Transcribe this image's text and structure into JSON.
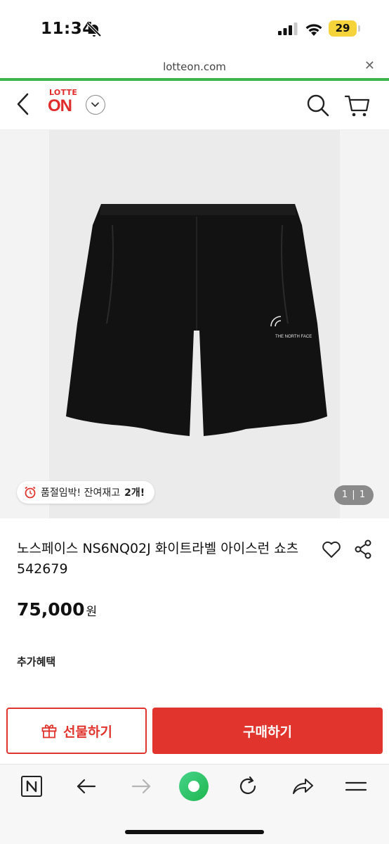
{
  "status_bar": {
    "time": "11:34",
    "battery_level": "29"
  },
  "browser": {
    "url": "lotteon.com",
    "close_label": "✕",
    "load_progress": 1.0
  },
  "header": {
    "logo_top": "LOTTE",
    "logo_main": "ON"
  },
  "gallery": {
    "stock_text": "품절임박! 잔여재고 ",
    "stock_count": "2개!",
    "page_indicator": "1 | 1"
  },
  "product": {
    "title": "노스페이스 NS6NQ02J 화이트라벨 아이스런 쇼츠 542679",
    "price": "75,000",
    "price_unit": "원",
    "benefits_label": "추가혜택"
  },
  "actions": {
    "gift_label": "선물하기",
    "buy_label": "구매하기"
  },
  "colors": {
    "brand_red": "#e0342d",
    "progress_green": "#3cb449",
    "battery_yellow": "#f5d33b"
  }
}
